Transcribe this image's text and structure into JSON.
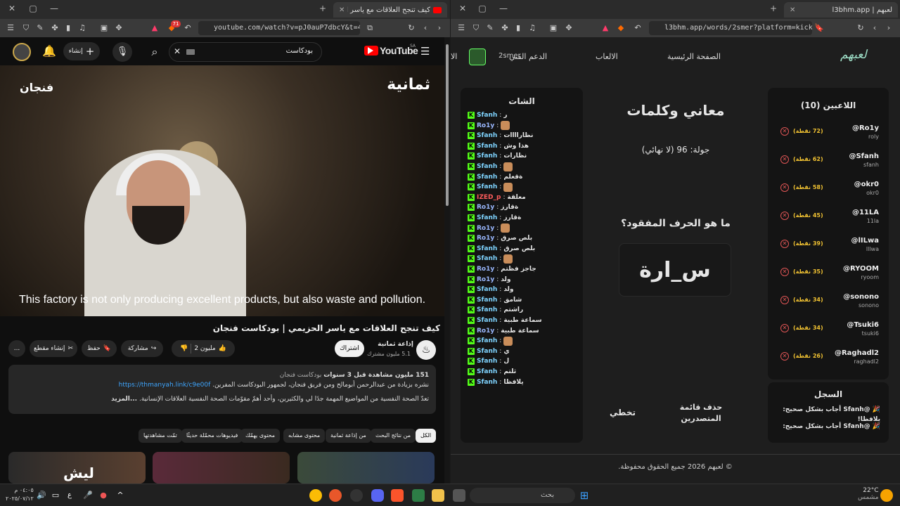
{
  "left_browser": {
    "tab_title": "كيف تنجح العلاقات مع ياسر الحز",
    "tab_new": "+",
    "url": "youtube.com/watch?v=pJ0auP7dbcY&t=4...",
    "ext_badge": "71",
    "youtube": {
      "logo": "YouTube",
      "logo_region": "SA",
      "search_value": "بودكاست",
      "create_label": "إنشاء",
      "video": {
        "brand_left": "ثمانية",
        "brand_right": "فنجان",
        "subtitle": "This factory is not only producing excellent products, but also waste and pollution."
      },
      "title": "كيف تنجح العلاقات مع ياسر الحزيمي | بودكاست فنجان",
      "channel_name": "إذاعة ثمانية",
      "subscribers": "5.1 مليون مشترك",
      "subscribe_label": "اشتراك",
      "likes": "2 مليون",
      "share_label": "مشاركة",
      "save_label": "حفظ",
      "clip_label": "إنشاء مقطع",
      "more_label": "...",
      "description": {
        "stats": "151 مليون مشاهدة  قبل 3 سنوات",
        "tag": "بودكاست فنجان",
        "line1": "نشره بزيادة من عبدالرحمن أبومالح ومن فريق فنجان، لجمهور البودكاست المفرين.",
        "link": "https://thmanyah.link/c9e00f",
        "line2": "تعدّ الصحة النفسية من المواضيع المهمة جدًا لي والكثيرين، وأحد أهمّ مقوّمات الصحة النفسية العلاقات الإنسانية.",
        "more": "...المزيد"
      },
      "chips": [
        "الكل",
        "من نتائج البحث",
        "من إذاعة ثمانية",
        "محتوى مشابه",
        "محتوى يهمّك",
        "فيديوهات محمّلة حديثًا",
        "تمّت مشاهدتها"
      ],
      "thumb_text": "ليش"
    }
  },
  "right_browser": {
    "tab_title": "لعبهم | l3bhm.app",
    "url": "l3bhm.app/words/2smer?platform=kick",
    "logo": "لعبهم",
    "nav": [
      "الصفحة الرئيسية",
      "الالعاب",
      "الدعم الفني",
      "الا"
    ],
    "username": "2smer",
    "players_title": "اللاعبين (10)",
    "players": [
      {
        "name": "@Ro1y",
        "user": "roly",
        "points": "(72 نقطة)"
      },
      {
        "name": "@Sfanh",
        "user": "sfanh",
        "points": "(62 نقطة)"
      },
      {
        "name": "@okr0",
        "user": "okr0",
        "points": "(58 نقطة)"
      },
      {
        "name": "@11LA",
        "user": "11la",
        "points": "(45 نقطة)"
      },
      {
        "name": "@lILwa",
        "user": "lllwa",
        "points": "(39 نقطة)"
      },
      {
        "name": "@RYOOM",
        "user": "ryoom",
        "points": "(35 نقطة)"
      },
      {
        "name": "@sonono",
        "user": "sonono",
        "points": "(34 نقطة)"
      },
      {
        "name": "@Tsuki6",
        "user": "tsuki6",
        "points": "(34 نقطة)"
      },
      {
        "name": "@Raghadl2",
        "user": "raghadl2",
        "points": "(26 نقطة)"
      }
    ],
    "game_title": "معاني وكلمات",
    "round": "جولة: 96 (لا نهائي)",
    "question": "ما هو الحرف المفقود؟",
    "word": "س_ارة",
    "skip_label": "تخطي",
    "clear_label": "حذف قائمة المتصدرين",
    "chat_title": "الشات",
    "chat": [
      {
        "u": "Sfanh",
        "t": "ر",
        "e": false
      },
      {
        "u": "Ro1y",
        "t": "",
        "e": true
      },
      {
        "u": "Sfanh",
        "t": "نظاراااات",
        "e": false
      },
      {
        "u": "Sfanh",
        "t": "هذا وش",
        "e": false
      },
      {
        "u": "Sfanh",
        "t": "نظارات",
        "e": false
      },
      {
        "u": "Sfanh",
        "t": "",
        "e": true
      },
      {
        "u": "Sfanh",
        "t": "ةقعلم",
        "e": false
      },
      {
        "u": "Sfanh",
        "t": "",
        "e": true
      },
      {
        "u": "IZED_p",
        "t": "معلقة",
        "e": false
      },
      {
        "u": "Ro1y",
        "t": "ةقارز",
        "e": false
      },
      {
        "u": "Sfanh",
        "t": "ةقارز",
        "e": false
      },
      {
        "u": "Ro1y",
        "t": "",
        "e": true
      },
      {
        "u": "Ro1y",
        "t": "بلص صرق",
        "e": false
      },
      {
        "u": "Sfanh",
        "t": "بلص صرق",
        "e": false
      },
      {
        "u": "Sfanh",
        "t": "",
        "e": true
      },
      {
        "u": "Ro1y",
        "t": "جاجز فظتم",
        "e": false
      },
      {
        "u": "Ro1y",
        "t": "ولد",
        "e": false
      },
      {
        "u": "Sfanh",
        "t": "ولد",
        "e": false
      },
      {
        "u": "Sfanh",
        "t": "شامق",
        "e": false
      },
      {
        "u": "Sfanh",
        "t": "راشتم",
        "e": false
      },
      {
        "u": "Sfanh",
        "t": "سماعة طبية",
        "e": false
      },
      {
        "u": "Ro1y",
        "t": "سماعة طبية",
        "e": false
      },
      {
        "u": "Sfanh",
        "t": "",
        "e": true
      },
      {
        "u": "Sfanh",
        "t": "ي",
        "e": false
      },
      {
        "u": "Sfanh",
        "t": "ل",
        "e": false
      },
      {
        "u": "Sfanh",
        "t": "ثلتم",
        "e": false
      },
      {
        "u": "Sfanh",
        "t": "يلافظا",
        "e": false
      }
    ],
    "log_title": "السجل",
    "log": [
      "🎉 @Sfanh أجاب بشكل صحيح: يلافظا!",
      "🎉 @Sfanh أجاب بشكل صحيح:"
    ],
    "footer": "© لعبهم 2026 جميع الحقوق محفوظة."
  },
  "taskbar": {
    "search": "بحث",
    "weather_temp": "22°C",
    "weather_desc": "مشمس",
    "time": "٠٤:٠٥ م",
    "date": "٢٠٢٥/٠٧/١٢",
    "lang": "ع"
  }
}
